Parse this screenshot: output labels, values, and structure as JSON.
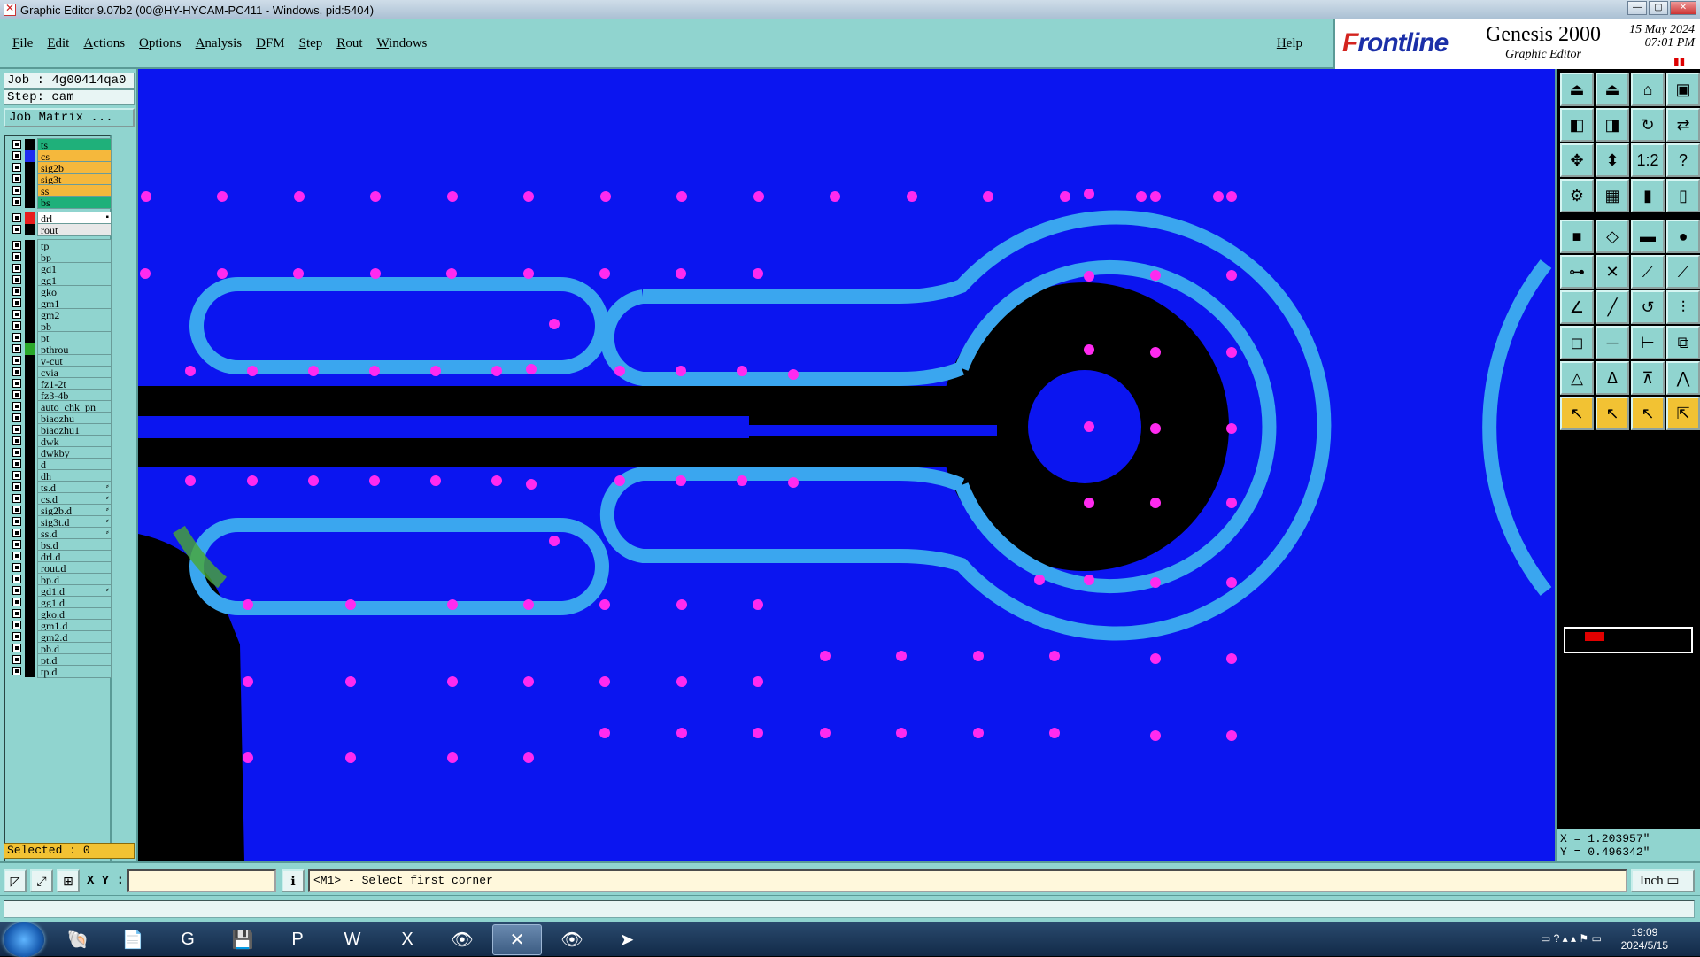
{
  "window": {
    "title": "Graphic Editor 9.07b2 (00@HY-HYCAM-PC411 - Windows, pid:5404)"
  },
  "menu": {
    "items": [
      "File",
      "Edit",
      "Actions",
      "Options",
      "Analysis",
      "DFM",
      "Step",
      "Rout",
      "Windows"
    ],
    "help": "Help"
  },
  "brand": {
    "logo_prefix": "F",
    "logo_rest": "rontline",
    "product": "Genesis 2000",
    "subtitle": "Graphic Editor",
    "date": "15 May 2024",
    "time": "07:01 PM"
  },
  "job": {
    "job_line": "Job : 4g00414qa0",
    "step_line": "Step: cam",
    "matrix_button": "Job Matrix ..."
  },
  "colors": {
    "canvas_bg": "#0b15f0",
    "pad": "#ff2af0",
    "trace": "#3aa6ef",
    "void": "#000000",
    "panel": "#90d4cf",
    "accent_signal": "#f5b83c",
    "accent_mask": "#1fb07a"
  },
  "layers": [
    {
      "name": "ts",
      "swatch": "#000000",
      "bg": "#1fb07a"
    },
    {
      "name": "cs",
      "swatch": "#1e2cf0",
      "bg": "#f5b83c"
    },
    {
      "name": "sig2b",
      "swatch": "#000000",
      "bg": "#f5b83c"
    },
    {
      "name": "sig3t",
      "swatch": "#000000",
      "bg": "#f5b83c"
    },
    {
      "name": "ss",
      "swatch": "#000000",
      "bg": "#f5b83c"
    },
    {
      "name": "bs",
      "swatch": "#000000",
      "bg": "#1fb07a"
    },
    {
      "name": "drl",
      "swatch": "#e81c1c",
      "bg": "#ffffff",
      "flag": "▪",
      "gap": true
    },
    {
      "name": "rout",
      "swatch": "#000000",
      "bg": "#e8e8e8"
    },
    {
      "name": "tp",
      "swatch": "#000000",
      "bg": "#90d4cf",
      "gap": true
    },
    {
      "name": "bp",
      "swatch": "#000000",
      "bg": "#90d4cf"
    },
    {
      "name": "gd1",
      "swatch": "#000000",
      "bg": "#90d4cf"
    },
    {
      "name": "gg1",
      "swatch": "#000000",
      "bg": "#90d4cf"
    },
    {
      "name": "gko",
      "swatch": "#000000",
      "bg": "#90d4cf"
    },
    {
      "name": "gm1",
      "swatch": "#000000",
      "bg": "#90d4cf"
    },
    {
      "name": "gm2",
      "swatch": "#000000",
      "bg": "#90d4cf"
    },
    {
      "name": "pb",
      "swatch": "#000000",
      "bg": "#90d4cf"
    },
    {
      "name": "pt",
      "swatch": "#000000",
      "bg": "#90d4cf"
    },
    {
      "name": "pthrou",
      "swatch": "#2aa82a",
      "bg": "#90d4cf"
    },
    {
      "name": "v-cut",
      "swatch": "#000000",
      "bg": "#90d4cf"
    },
    {
      "name": "cvia",
      "swatch": "#000000",
      "bg": "#90d4cf"
    },
    {
      "name": "fz1-2t",
      "swatch": "#000000",
      "bg": "#90d4cf"
    },
    {
      "name": "fz3-4b",
      "swatch": "#000000",
      "bg": "#90d4cf"
    },
    {
      "name": "auto_chk_pn",
      "swatch": "#000000",
      "bg": "#90d4cf"
    },
    {
      "name": "biaozhu",
      "swatch": "#000000",
      "bg": "#90d4cf"
    },
    {
      "name": "biaozhu1",
      "swatch": "#000000",
      "bg": "#90d4cf"
    },
    {
      "name": "dwk",
      "swatch": "#000000",
      "bg": "#90d4cf"
    },
    {
      "name": "dwkby",
      "swatch": "#000000",
      "bg": "#90d4cf"
    },
    {
      "name": "d",
      "swatch": "#000000",
      "bg": "#90d4cf"
    },
    {
      "name": "dh",
      "swatch": "#000000",
      "bg": "#90d4cf"
    },
    {
      "name": "ts.d",
      "swatch": "#000000",
      "bg": "#90d4cf",
      "flag": "⸗"
    },
    {
      "name": "cs.d",
      "swatch": "#000000",
      "bg": "#90d4cf",
      "flag": "⸗"
    },
    {
      "name": "sig2b.d",
      "swatch": "#000000",
      "bg": "#90d4cf",
      "flag": "⸗"
    },
    {
      "name": "sig3t.d",
      "swatch": "#000000",
      "bg": "#90d4cf",
      "flag": "⸗"
    },
    {
      "name": "ss.d",
      "swatch": "#000000",
      "bg": "#90d4cf",
      "flag": "⸗"
    },
    {
      "name": "bs.d",
      "swatch": "#000000",
      "bg": "#90d4cf"
    },
    {
      "name": "drl.d",
      "swatch": "#000000",
      "bg": "#90d4cf"
    },
    {
      "name": "rout.d",
      "swatch": "#000000",
      "bg": "#90d4cf"
    },
    {
      "name": "bp.d",
      "swatch": "#000000",
      "bg": "#90d4cf"
    },
    {
      "name": "gd1.d",
      "swatch": "#000000",
      "bg": "#90d4cf",
      "flag": "⸗"
    },
    {
      "name": "gg1.d",
      "swatch": "#000000",
      "bg": "#90d4cf"
    },
    {
      "name": "gko.d",
      "swatch": "#000000",
      "bg": "#90d4cf"
    },
    {
      "name": "gm1.d",
      "swatch": "#000000",
      "bg": "#90d4cf"
    },
    {
      "name": "gm2.d",
      "swatch": "#000000",
      "bg": "#90d4cf"
    },
    {
      "name": "pb.d",
      "swatch": "#000000",
      "bg": "#90d4cf"
    },
    {
      "name": "pt.d",
      "swatch": "#000000",
      "bg": "#90d4cf"
    },
    {
      "name": "tp.d",
      "swatch": "#000000",
      "bg": "#90d4cf"
    }
  ],
  "selected": "Selected : 0",
  "coords": {
    "x": "X = 1.203957\"",
    "y": "Y = 0.496342\""
  },
  "cmd": {
    "xy_label": "X Y :",
    "xy_value": "",
    "message": "<M1> - Select first corner",
    "units": "Inch"
  },
  "toolbar": [
    "house-up",
    "house-down",
    "home",
    "layout",
    "page-left",
    "page-right",
    "loop",
    "swap",
    "fit",
    "zoom-mid",
    "ratio",
    "help",
    "probe",
    "grid",
    "red-split",
    "red-join",
    "snap-box",
    "move-shape",
    "ruler",
    "dot",
    "connect",
    "cross",
    "line-dot",
    "snap-line",
    "angle",
    "slope",
    "arc",
    "fork",
    "add-pad",
    "line",
    "measure",
    "array",
    "triangle-a",
    "arrow-a",
    "bridge-a",
    "tent",
    "select",
    "select-2",
    "select-3",
    "select-all"
  ],
  "toolbar_glyphs": [
    "⏏",
    "⏏",
    "⌂",
    "▣",
    "◧",
    "◨",
    "↻",
    "⇄",
    "✥",
    "⬍",
    "1:2",
    "?",
    "⚙",
    "▦",
    "▮",
    "▯",
    "■",
    "◇",
    "▬",
    "●",
    "⊶",
    "✕",
    "⟋",
    "⟋",
    "∠",
    "╱",
    "↺",
    "⫶",
    "◻",
    "─",
    "⊢",
    "⧉",
    "△",
    "Δ",
    "⊼",
    "⋀",
    "↖",
    "↖",
    "↖",
    "⇱"
  ],
  "taskbar": {
    "clock": "19:09",
    "date": "2024/5/15"
  },
  "taskbar_icons": [
    "shell-icon",
    "notepad-icon",
    "browser-icon",
    "save-disk-icon",
    "publisher-icon",
    "word-icon",
    "excel-icon",
    "eye-tool-icon",
    "genesis-icon",
    "eye-tool-icon-2",
    "arrow-app-icon"
  ],
  "taskbar_glyphs": [
    "🐚",
    "📄",
    "G",
    "💾",
    "P",
    "W",
    "X",
    "👁",
    "✕",
    "👁",
    "➤"
  ]
}
